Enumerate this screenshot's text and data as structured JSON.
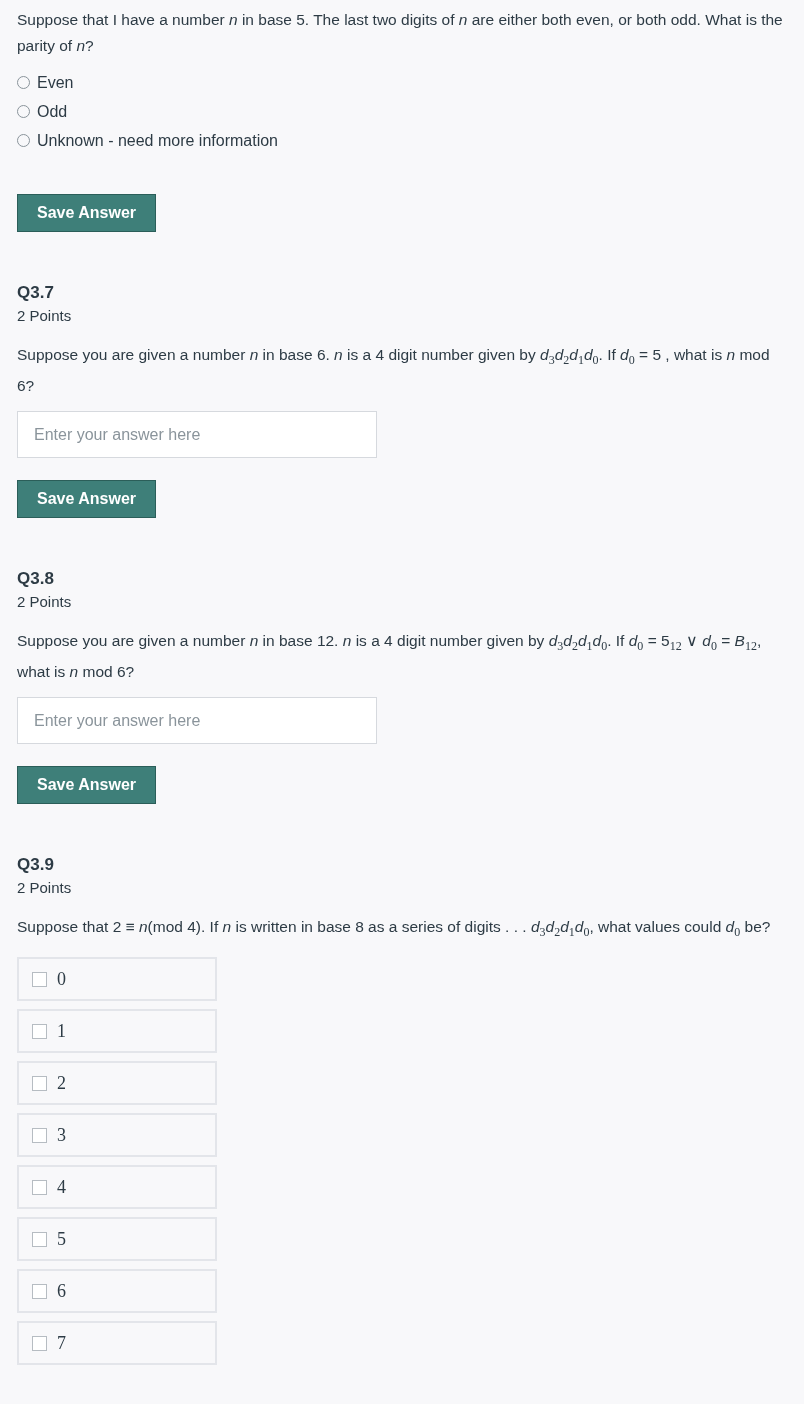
{
  "questions": [
    {
      "kind": "radio",
      "prompt": "Suppose that I have a number *n* in base 5. The last two digits of *n* are either both even, or both odd. What is the parity of *n*?",
      "options": [
        {
          "label": "Even",
          "selected": false
        },
        {
          "label": "Odd",
          "selected": false
        },
        {
          "label": "Unknown - need more information",
          "selected": false
        }
      ],
      "save_button": "Save Answer"
    },
    {
      "kind": "text",
      "number": "Q3.7",
      "points": "2 Points",
      "prompt": "Suppose you are given a number *n* in base 6. *n* is a 4 digit number given by *d*$_{3}$*d*$_{2}$*d*$_{1}$*d*$_{0}$. If *d*$_{0}$ = 5 , what is *n* mod 6?",
      "placeholder": "Enter your answer here",
      "save_button": "Save Answer"
    },
    {
      "kind": "text",
      "number": "Q3.8",
      "points": "2 Points",
      "prompt": "Suppose you are given a number *n* in base 12. *n* is a 4 digit number given by *d*$_{3}$*d*$_{2}$*d*$_{1}$*d*$_{0}$. If *d*$_{0}$ = 5$_{12}$ ∨ *d*$_{0}$ = *B*$_{12}$, what is *n* mod 6?",
      "placeholder": "Enter your answer here",
      "save_button": "Save Answer"
    },
    {
      "kind": "checkbox",
      "number": "Q3.9",
      "points": "2 Points",
      "prompt": "Suppose that 2 ≡ *n*(mod 4). If *n* is written in base 8 as a series of digits . . . *d*$_{3}$*d*$_{2}$*d*$_{1}$*d*$_{0}$, what values could *d*$_{0}$ be?",
      "options": [
        {
          "label": "0",
          "checked": false
        },
        {
          "label": "1",
          "checked": false
        },
        {
          "label": "2",
          "checked": false
        },
        {
          "label": "3",
          "checked": false
        },
        {
          "label": "4",
          "checked": false
        },
        {
          "label": "5",
          "checked": false
        },
        {
          "label": "6",
          "checked": false
        },
        {
          "label": "7",
          "checked": false
        }
      ]
    }
  ]
}
